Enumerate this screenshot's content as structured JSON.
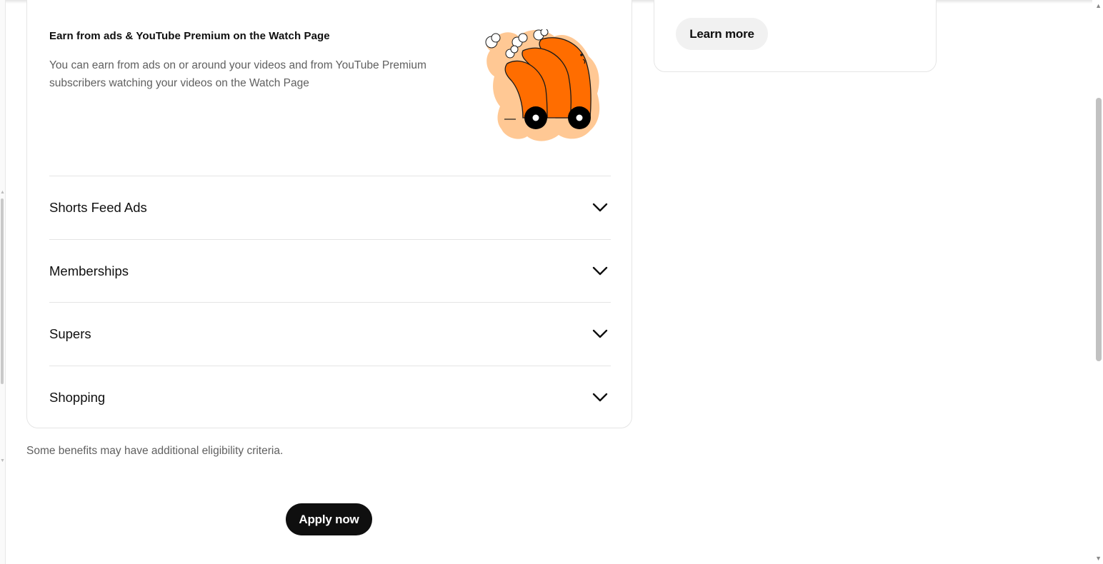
{
  "watch_page": {
    "title": "Earn from ads & YouTube Premium on the Watch Page",
    "description": "You can earn from ads on or around your videos and from YouTube Premium subscribers watching your videos on the Watch Page"
  },
  "accordion": {
    "items": [
      {
        "label": "Shorts Feed Ads"
      },
      {
        "label": "Memberships"
      },
      {
        "label": "Supers"
      },
      {
        "label": "Shopping"
      }
    ]
  },
  "footnote": "Some benefits may have additional eligibility criteria.",
  "buttons": {
    "apply": "Apply now",
    "learn_more": "Learn more"
  },
  "colors": {
    "illustration_orange": "#ff6d00",
    "illustration_halo": "#ffc894",
    "primary_button": "#0f0f0f",
    "secondary_button": "#f1f1f1"
  },
  "icons": {
    "chevron": "chevron-down-icon",
    "illustration": "orange-creatures-cart-illustration"
  }
}
